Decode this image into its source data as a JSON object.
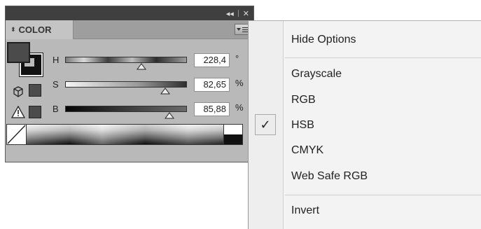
{
  "panel": {
    "tab_label": "COLOR",
    "titlebar_collapse_glyph": "◂◂",
    "titlebar_close_glyph": "✕",
    "sliders": [
      {
        "letter": "H",
        "value": "228,4",
        "unit": "°",
        "level": 0.63
      },
      {
        "letter": "S",
        "value": "82,65",
        "unit": "%",
        "level": 0.8265
      },
      {
        "letter": "B",
        "value": "85,88",
        "unit": "%",
        "level": 0.8588
      }
    ]
  },
  "menu": {
    "items": {
      "hide_options": "Hide Options",
      "grayscale": "Grayscale",
      "rgb": "RGB",
      "hsb": "HSB",
      "cmyk": "CMYK",
      "web_safe_rgb": "Web Safe RGB",
      "invert": "Invert"
    },
    "checked_item": "HSB",
    "check_glyph": "✓"
  },
  "colors": {
    "panel_bg": "#b9b9b9",
    "titlebar": "#3f3f3f",
    "menu_bg": "#f3f3f3"
  }
}
